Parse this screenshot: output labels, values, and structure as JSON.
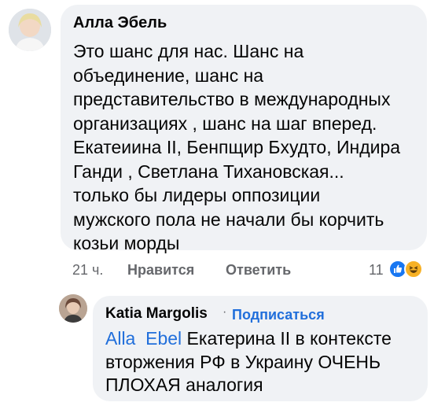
{
  "comment": {
    "author": "Алла Эбель",
    "lines": [
      "Это шанс для нас. Шанс на",
      "объединение, шанс на",
      "представительство в международных",
      "организациях , шанс на шаг вперед.",
      "Екатеиина II, Бенпщир Бхудто, Индира",
      "Ганди , Светлана Тихановская...",
      "только бы лидеры оппозиции",
      "мужского пола не начали бы корчить",
      "козьи морды"
    ],
    "time": "21 ч.",
    "like_label": "Нравится",
    "reply_label": "Ответить",
    "reaction_count": "11",
    "reaction_icons": [
      "like-icon",
      "haha-icon"
    ]
  },
  "reply": {
    "author": "Katia Margolis",
    "separator": "·",
    "subscribe_label": "Подписаться",
    "mention": "Alla  Ebel",
    "line1_rest": " Екатерина II в контексте",
    "line2": "вторжения РФ в Украину ОЧЕНЬ",
    "line3": "ПЛОХАЯ аналогия"
  },
  "colors": {
    "bubble": "#f0f2f5",
    "link": "#216fdb",
    "meta": "#65676b"
  }
}
